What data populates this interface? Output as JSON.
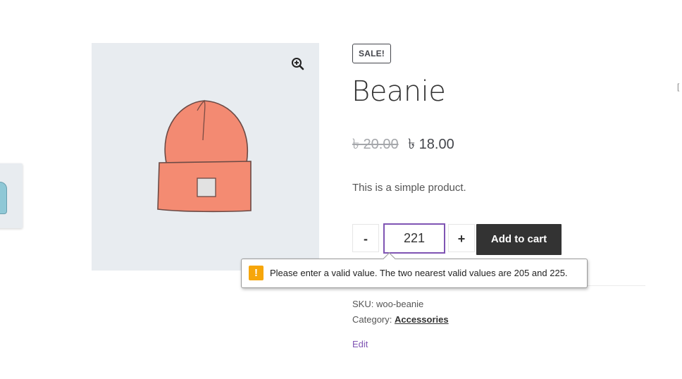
{
  "badge": {
    "sale_label": "SALE!"
  },
  "product": {
    "title": "Beanie",
    "regular_price": "৳ 20.00",
    "sale_price": "৳ 18.00",
    "short_description": "This is a simple product."
  },
  "cart_form": {
    "minus_label": "-",
    "plus_label": "+",
    "quantity_value": "221",
    "add_to_cart_label": "Add to cart"
  },
  "validation": {
    "icon_glyph": "!",
    "message": "Please enter a valid value. The two nearest valid values are 205 and 225."
  },
  "meta": {
    "sku_label": "SKU:",
    "sku_value": "woo-beanie",
    "category_label": "Category:",
    "category_value": "Accessories"
  },
  "admin": {
    "edit_label": "Edit"
  },
  "edge_text": "[",
  "icons": {
    "zoom": "zoom-in-icon",
    "warning": "warning-icon"
  },
  "colors": {
    "accent": "#7f54b3",
    "button_bg": "#333333",
    "warning": "#f6a60a",
    "image_bg": "#e8ecf0",
    "hat": "#f38a72"
  }
}
